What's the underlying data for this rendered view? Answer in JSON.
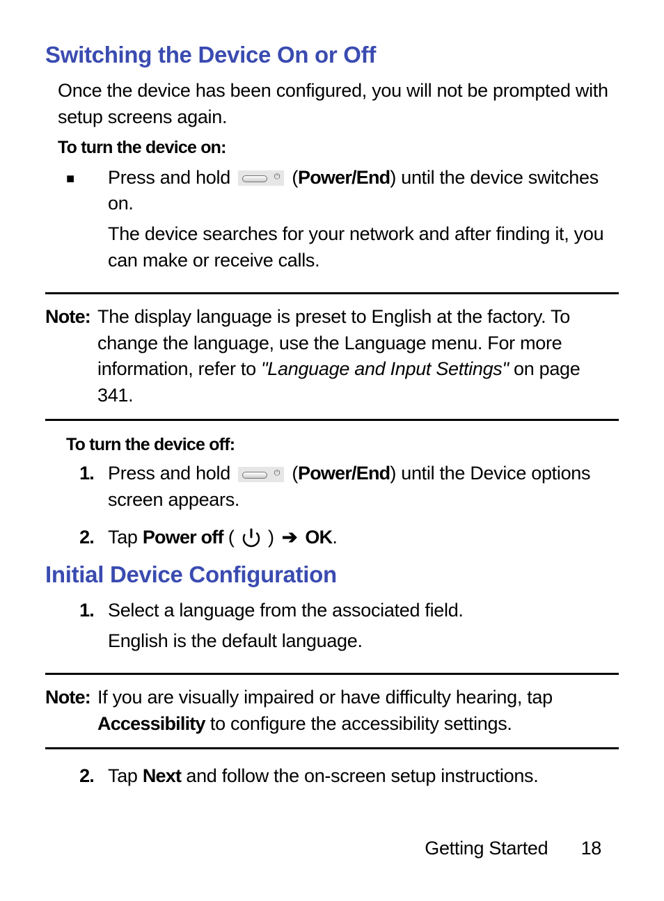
{
  "section1": {
    "title": "Switching the Device On or Off",
    "intro": "Once the device has been configured, you will not be prompted with setup screens again.",
    "turnOnHeading": "To turn the device on:",
    "bullet": {
      "pre": "Press and hold ",
      "label": "Power/End",
      "post": ") until the device switches on.",
      "followup": "The device searches for your network and after finding it, you can make or receive calls."
    },
    "note1": {
      "label": "Note:",
      "pre": "The display language is preset to English at the factory. To change the language, use the Language menu. For more information, refer to ",
      "ref": "\"Language and Input Settings\"",
      "post": " on page 341."
    },
    "turnOffHeading": "To turn the device off:",
    "off1": {
      "pre": "Press and hold ",
      "label": "Power/End",
      "post": ") until the Device options screen appears."
    },
    "off2": {
      "tap": "Tap ",
      "poweroff": "Power off",
      "open": " ( ",
      "close": " ) ",
      "arrow": "➔",
      "ok": "OK",
      "dot": "."
    }
  },
  "section2": {
    "title": "Initial Device Configuration",
    "step1a": "Select a language from the associated field.",
    "step1b": "English is the default language.",
    "note2": {
      "label": "Note:",
      "pre": "If you are visually impaired or have difficulty hearing, tap ",
      "bold": "Accessibility",
      "post": " to configure the accessibility settings."
    },
    "step2": {
      "tap": "Tap ",
      "next": "Next",
      "rest": " and follow the on-screen setup instructions."
    }
  },
  "footer": {
    "chapter": "Getting Started",
    "page": "18"
  },
  "markers": {
    "square": "■",
    "n1": "1.",
    "n2": "2."
  }
}
